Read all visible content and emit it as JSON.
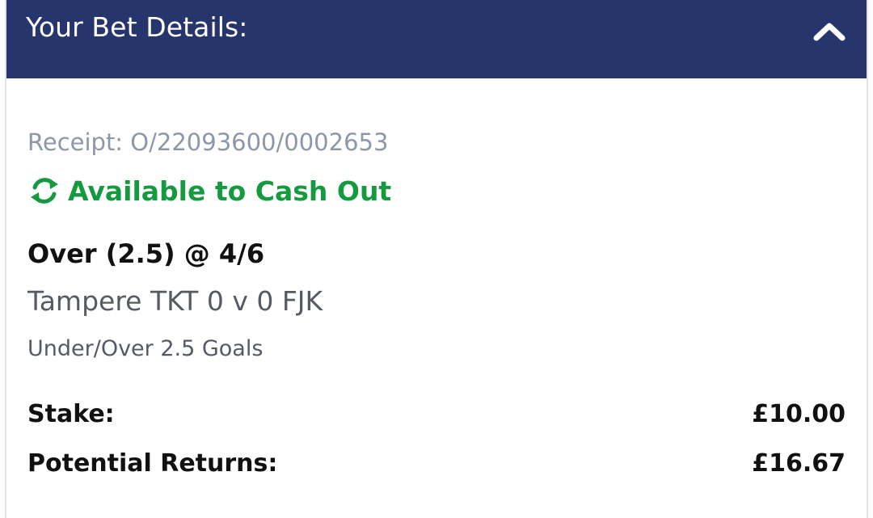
{
  "header": {
    "title": "Your Bet Details:",
    "collapse_icon": "chevron-up-icon"
  },
  "bet": {
    "receipt": "Receipt: O/22093600/0002653",
    "cashout_icon": "refresh-arrows-icon",
    "cashout_label": "Available to Cash Out",
    "selection": "Over (2.5) @ 4/6",
    "event": "Tampere TKT 0 v 0 FJK",
    "market": "Under/Over 2.5 Goals",
    "stake_label": "Stake:",
    "stake_value": "£10.00",
    "returns_label": "Potential Returns:",
    "returns_value": "£16.67"
  },
  "colors": {
    "header_bg": "#26356b",
    "cashout_green": "#169a3f",
    "receipt_grey": "#8e97a8",
    "border": "#dfe3ea"
  }
}
